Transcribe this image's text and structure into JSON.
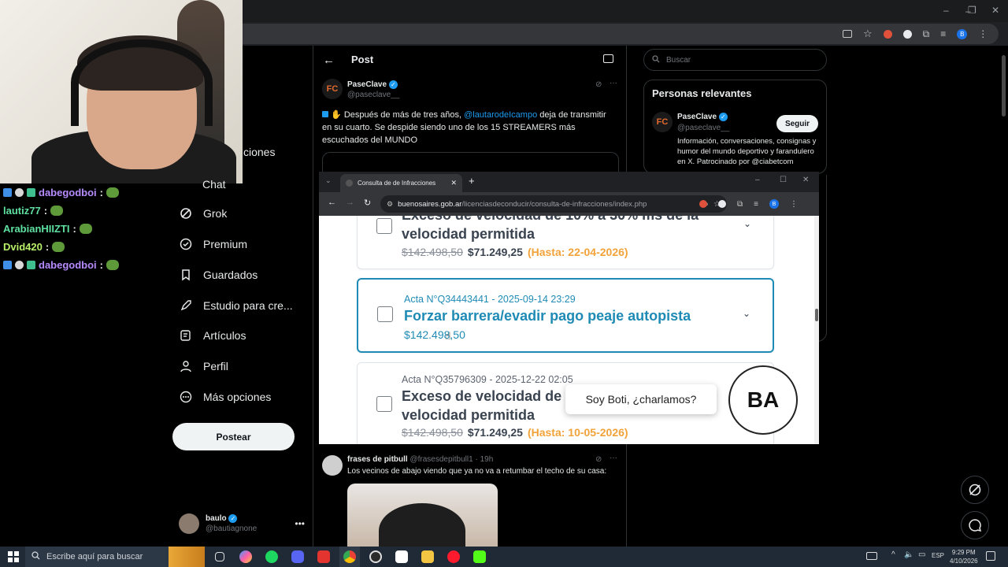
{
  "main_browser": {
    "window_controls": {
      "minimize": "–",
      "restore": "❐",
      "close": "✕"
    }
  },
  "stream_chat": [
    {
      "user": "dabegodboi",
      "color": "#b68cff"
    },
    {
      "user": "lautiz77",
      "color": "#5ee0a0"
    },
    {
      "user": "ArabianHIIZTI",
      "color": "#5ee0a0"
    },
    {
      "user": "Dvid420",
      "color": "#b8f06a"
    },
    {
      "user": "dabegodboi",
      "color": "#b68cff"
    }
  ],
  "sidebar": {
    "partial_top_label": "ciones",
    "partial_chat_label": "Chat",
    "items": [
      {
        "label": "Grok",
        "icon": "grok-icon"
      },
      {
        "label": "Premium",
        "icon": "premium-icon"
      },
      {
        "label": "Guardados",
        "icon": "bookmark-icon"
      },
      {
        "label": "Estudio para cre...",
        "icon": "rocket-icon"
      },
      {
        "label": "Artículos",
        "icon": "article-icon"
      },
      {
        "label": "Perfil",
        "icon": "profile-icon"
      },
      {
        "label": "Más opciones",
        "icon": "more-icon"
      }
    ],
    "post_button": "Postear",
    "account": {
      "name": "baulo",
      "handle": "@bautiagnone"
    }
  },
  "timeline": {
    "header_title": "Post",
    "main_post": {
      "author": "PaseClave",
      "handle": "@paseclave__",
      "text_before_mention": "Después de más de tres años, ",
      "mention": "@lautarodeIcampo",
      "text_after_mention": " deja de transmitir en su cuarto. Se despide siendo uno de los 15 STREAMERS más escuchados del MUNDO"
    },
    "reply": {
      "author": "frases de pitbull",
      "handle": "@frasesdepitbull1",
      "time": "19h",
      "text": "Los vecinos de abajo viendo que ya no va a retumbar el techo de su casa:"
    }
  },
  "right_column": {
    "search_placeholder": "Buscar",
    "relevant_title": "Personas relevantes",
    "person": {
      "name": "PaseClave",
      "handle": "@paseclave__",
      "bio": "Información, conversaciones, consignas y humor del mundo deportivo y farandulero en X. Patrocinado por @ciabetcom",
      "follow_label": "Seguir"
    }
  },
  "popup": {
    "tab_title": "Consulta de de Infracciones",
    "url_domain": "buenosaires.gob.ar",
    "url_path": "/licenciasdeconducir/consulta-de-infracciones/index.php",
    "actas": [
      {
        "id": "",
        "title": "Exceso de velocidad de 10% a 30% más de la velocidad permitida",
        "title_line1": "Exceso de velocidad de 10% a 30% ms de la",
        "title_line2": "velocidad permitida",
        "old_price": "$142.498,50",
        "new_price": "$71.249,25",
        "deadline": "(Hasta: 22-04-2026)"
      },
      {
        "id": "Acta N°Q34443441 - 2025-09-14 23:29",
        "title": "Forzar barrera/evadir pago peaje autopista",
        "price": "$142.498,50"
      },
      {
        "id": "Acta N°Q35796309 - 2025-12-22 02:05",
        "title_line1": "Exceso de velocidad de",
        "title_line2": "velocidad permitida",
        "old_price": "$142.498,50",
        "new_price": "$71.249,25",
        "deadline": "(Hasta: 10-05-2026)"
      }
    ],
    "boti_message": "Soy Boti, ¿charlamos?",
    "boti_logo": "BA"
  },
  "taskbar": {
    "search_placeholder": "Escribe aquí para buscar",
    "language": "ESP",
    "time": "9:29 PM",
    "date": "4/10/2026"
  }
}
